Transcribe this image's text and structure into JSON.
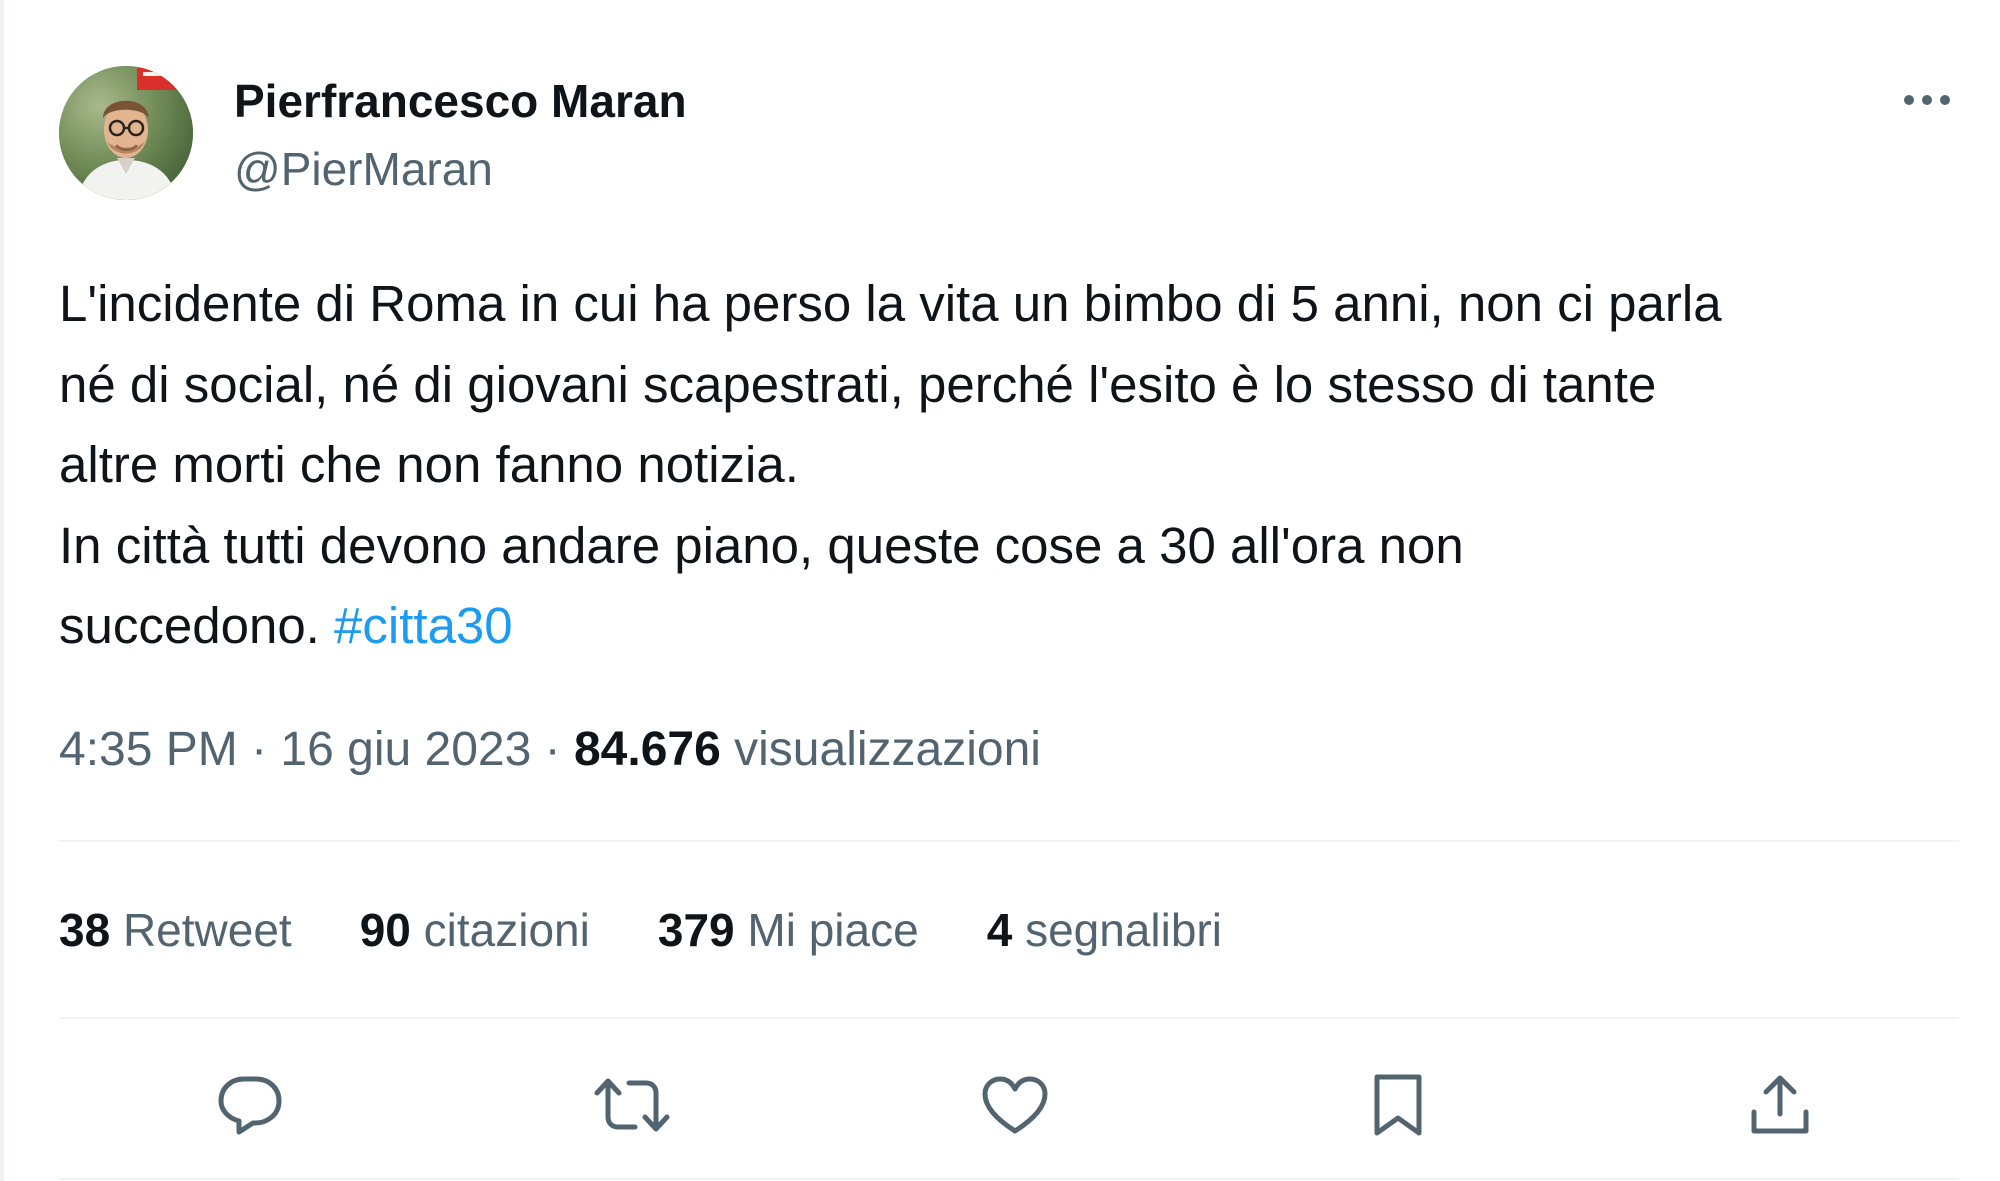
{
  "author": {
    "display_name": "Pierfrancesco Maran",
    "handle": "@PierMaran"
  },
  "tweet": {
    "text": "L'incidente di Roma in cui ha perso la vita un bimbo di 5 anni, non ci parla\nné di social, né di giovani scapestrati, perché l'esito è lo stesso di tante\naltre morti che non fanno notizia.\nIn città tutti devono andare piano, queste cose a 30 all'ora non\nsuccedono. ",
    "hashtag": "#citta30"
  },
  "meta": {
    "time": "4:35 PM",
    "separator": " · ",
    "date": "16 giu 2023",
    "views_count": "84.676",
    "views_label": "visualizzazioni"
  },
  "stats": [
    {
      "count": "38",
      "label": "Retweet"
    },
    {
      "count": "90",
      "label": "citazioni"
    },
    {
      "count": "379",
      "label": "Mi piace"
    },
    {
      "count": "4",
      "label": "segnalibri"
    }
  ],
  "icons": {
    "more": "more-horizontal-icon",
    "reply": "reply-icon",
    "retweet": "retweet-icon",
    "like": "heart-icon",
    "bookmark": "bookmark-icon",
    "share": "share-icon"
  },
  "colors": {
    "text": "#0f1419",
    "secondary": "#536471",
    "link": "#1d9bf0",
    "divider": "#eff3f4"
  }
}
